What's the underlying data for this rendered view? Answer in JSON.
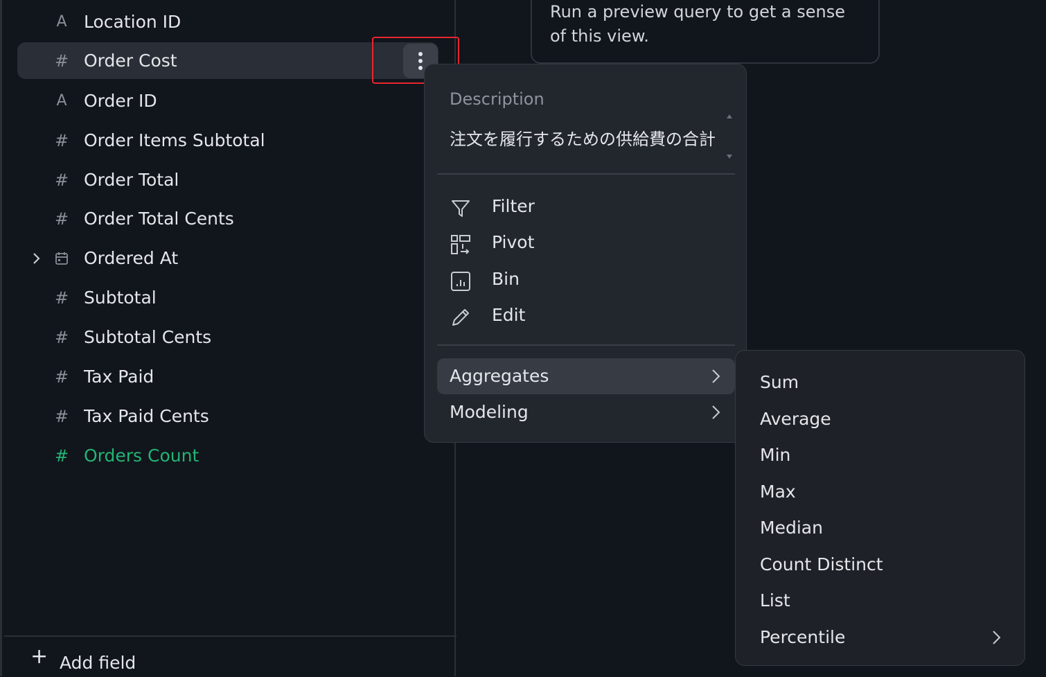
{
  "fields": [
    {
      "icon": "text-type-icon",
      "label": "Location ID"
    },
    {
      "icon": "number-type-icon",
      "label": "Order Cost"
    },
    {
      "icon": "text-type-icon",
      "label": "Order ID"
    },
    {
      "icon": "number-type-icon",
      "label": "Order Items Subtotal"
    },
    {
      "icon": "number-type-icon",
      "label": "Order Total"
    },
    {
      "icon": "number-type-icon",
      "label": "Order Total Cents"
    },
    {
      "icon": "calendar-type-icon",
      "label": "Ordered At"
    },
    {
      "icon": "number-type-icon",
      "label": "Subtotal"
    },
    {
      "icon": "number-type-icon",
      "label": "Subtotal Cents"
    },
    {
      "icon": "number-type-icon",
      "label": "Tax Paid"
    },
    {
      "icon": "number-type-icon",
      "label": "Tax Paid Cents"
    },
    {
      "icon": "number-type-icon",
      "label": "Orders Count"
    }
  ],
  "glyphs": {
    "number": "#",
    "text": "A",
    "add": "+"
  },
  "add_field_label": "Add field",
  "preview_hint": "Run a preview query to get a sense of this view.",
  "menu": {
    "description_title": "Description",
    "description_text": "注文を履行するための供給費の合計",
    "actions": [
      {
        "icon": "filter-icon",
        "label": "Filter"
      },
      {
        "icon": "pivot-icon",
        "label": "Pivot"
      },
      {
        "icon": "bin-icon",
        "label": "Bin"
      },
      {
        "icon": "edit-icon",
        "label": "Edit"
      }
    ],
    "groups": [
      {
        "label": "Aggregates",
        "icon": "chevron-right-icon"
      },
      {
        "label": "Modeling",
        "icon": "chevron-right-icon"
      }
    ]
  },
  "submenu": {
    "items": [
      "Sum",
      "Average",
      "Min",
      "Max",
      "Median",
      "Count Distinct",
      "List",
      "Percentile"
    ]
  },
  "colors": {
    "accent_green": "#22b573",
    "highlight_red": "#e8262c",
    "background": "#11151c",
    "menu_bg": "#22262d"
  }
}
